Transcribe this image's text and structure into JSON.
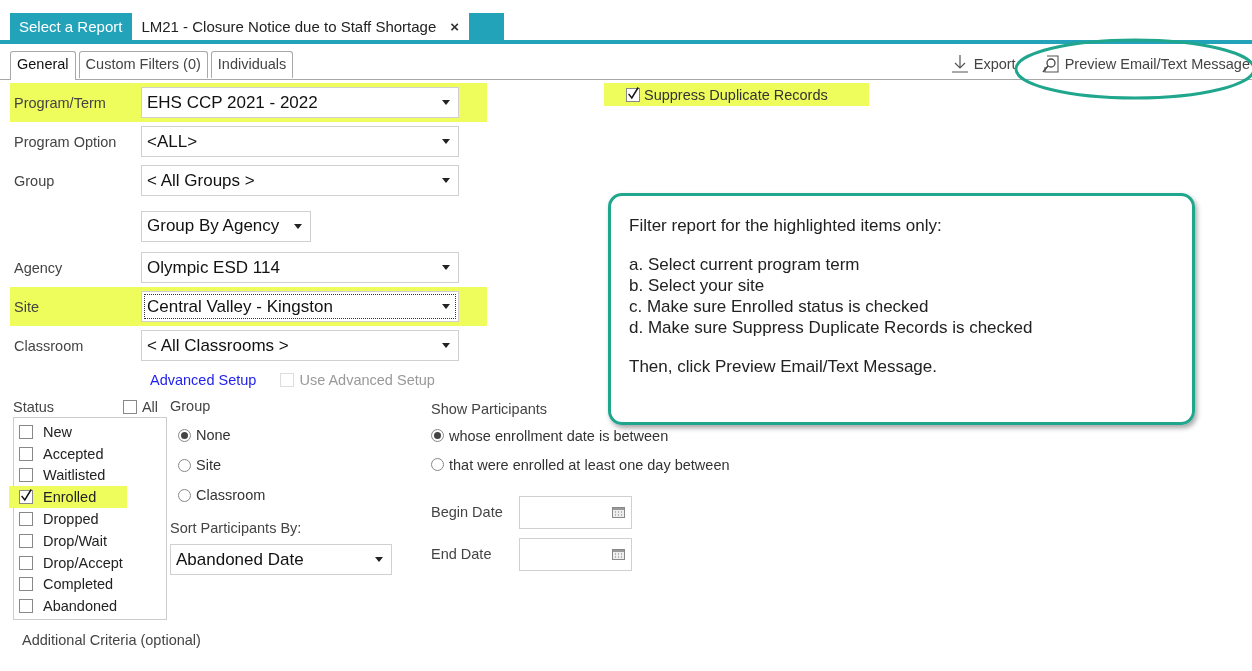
{
  "report_tabs": [
    {
      "label": "Select a Report",
      "selected": false
    },
    {
      "label": "LM21 - Closure Notice due to Staff Shortage",
      "selected": true,
      "close": "×"
    }
  ],
  "sub_tabs": [
    {
      "label": "General",
      "selected": true
    },
    {
      "label": "Custom Filters (0)",
      "selected": false
    },
    {
      "label": "Individuals",
      "selected": false
    }
  ],
  "toolbar": [
    {
      "kind": "export",
      "label": "Export",
      "circled": false
    },
    {
      "kind": "preview",
      "label": "Preview Email/Text Message",
      "circled": true
    }
  ],
  "suppress": {
    "label": "Suppress Duplicate Records",
    "checked": true,
    "highlighted": true
  },
  "fields": [
    {
      "kind": "select",
      "label": "Program/Term",
      "value": "EHS CCP 2021 - 2022",
      "highlighted": true,
      "focused": false
    },
    {
      "kind": "select",
      "label": "Program Option",
      "value": "<ALL>",
      "highlighted": false,
      "focused": false
    },
    {
      "kind": "select",
      "label": "Group",
      "value": "< All Groups >",
      "highlighted": false,
      "focused": false
    },
    {
      "kind": "compact",
      "value": "Group By Agency",
      "highlighted": false,
      "focused": false
    },
    {
      "kind": "select",
      "label": "Agency",
      "value": "Olympic ESD 114",
      "highlighted": false,
      "focused": false
    },
    {
      "kind": "select",
      "label": "Site",
      "value": "Central Valley - Kingston",
      "highlighted": true,
      "focused": true
    },
    {
      "kind": "select",
      "label": "Classroom",
      "value": "< All Classrooms >",
      "highlighted": false,
      "focused": false
    }
  ],
  "advanced": {
    "link": "Advanced Setup",
    "checkbox": {
      "label": "Use Advanced Setup",
      "checked": false,
      "disabled": true
    }
  },
  "status": {
    "label": "Status",
    "all": {
      "label": "All",
      "checked": false
    },
    "items": [
      {
        "label": "New",
        "checked": false,
        "highlighted": false
      },
      {
        "label": "Accepted",
        "checked": false,
        "highlighted": false
      },
      {
        "label": "Waitlisted",
        "checked": false,
        "highlighted": false
      },
      {
        "label": "Enrolled",
        "checked": true,
        "highlighted": true
      },
      {
        "label": "Dropped",
        "checked": false,
        "highlighted": false
      },
      {
        "label": "Drop/Wait",
        "checked": false,
        "highlighted": false
      },
      {
        "label": "Drop/Accept",
        "checked": false,
        "highlighted": false
      },
      {
        "label": "Completed",
        "checked": false,
        "highlighted": false
      },
      {
        "label": "Abandoned",
        "checked": false,
        "highlighted": false
      }
    ]
  },
  "group": {
    "label": "Group",
    "options": [
      {
        "label": "None",
        "selected": true
      },
      {
        "label": "Site",
        "selected": false
      },
      {
        "label": "Classroom",
        "selected": false
      }
    ]
  },
  "sort": {
    "label": "Sort Participants By:",
    "value": "Abandoned Date"
  },
  "show_participants": {
    "label": "Show Participants",
    "options": [
      {
        "label": "whose enrollment date is between",
        "selected": true
      },
      {
        "label": "that were enrolled at least one day between",
        "selected": false
      }
    ]
  },
  "dates": [
    {
      "label": "Begin Date"
    },
    {
      "label": "End Date"
    }
  ],
  "additional_criteria": "Additional Criteria (optional)",
  "callout": {
    "paragraphs": [
      [
        "Filter report for the highlighted items only:"
      ],
      [
        "a. Select current program term",
        "b. Select your site",
        "c. Make sure Enrolled status is checked",
        "d. Make sure Suppress Duplicate Records is checked"
      ],
      [
        "Then, click Preview Email/Text Message."
      ]
    ]
  }
}
